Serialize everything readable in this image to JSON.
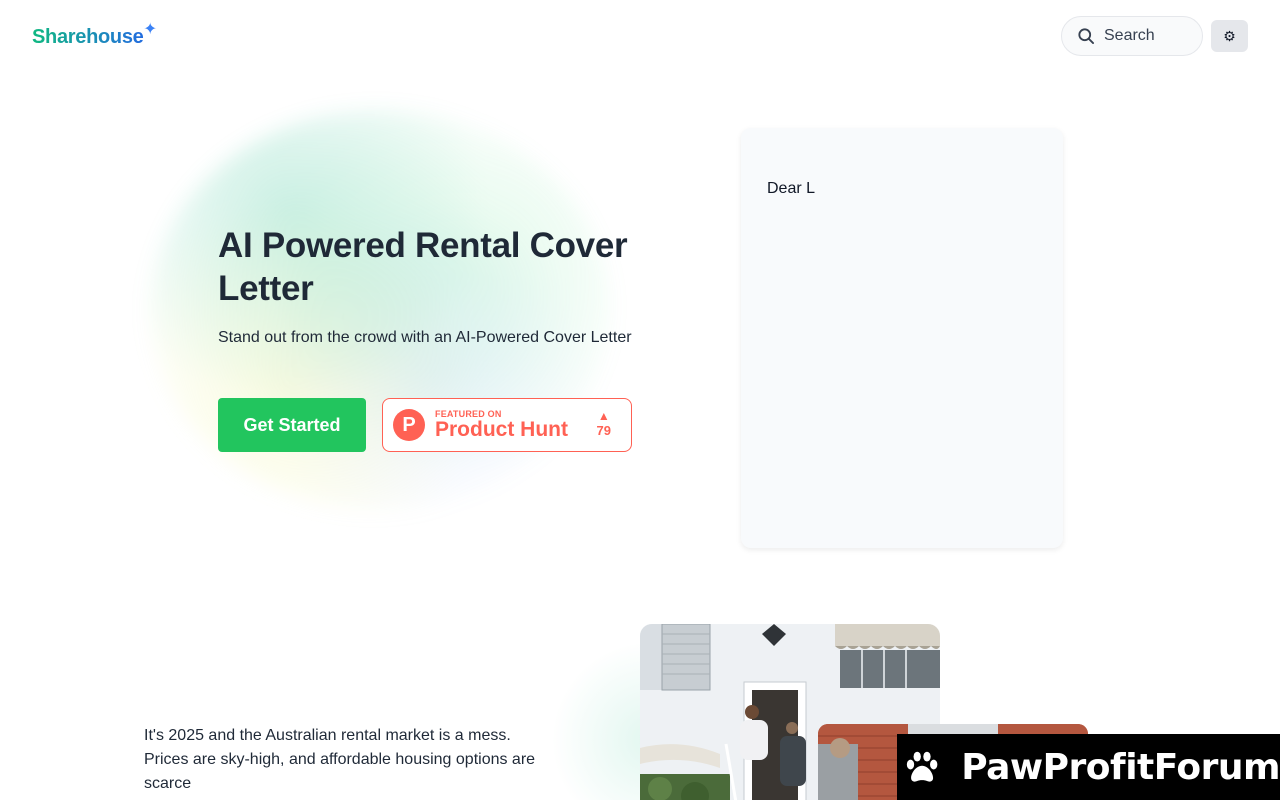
{
  "header": {
    "logo_text": "Sharehouse",
    "logo_spark": "✦",
    "search_label": "Search",
    "settings_glyph": "⚙"
  },
  "hero": {
    "title": "AI Powered Rental Cover Letter",
    "subtitle": "Stand out from the crowd with an AI-Powered Cover Letter",
    "cta_label": "Get Started",
    "product_hunt": {
      "logo_letter": "P",
      "featured_label": "FEATURED ON",
      "name": "Product Hunt",
      "arrow": "▲",
      "votes": "79"
    }
  },
  "letter_preview": {
    "text": "Dear L"
  },
  "intro": {
    "text": "It's 2025 and the Australian rental market is a mess. Prices are sky-high, and affordable housing options are scarce"
  },
  "watermark": {
    "text": "PawProfitForum"
  },
  "icons": {
    "search": "search-icon",
    "settings": "gear-icon",
    "paw": "paw-icon"
  },
  "colors": {
    "primary_green": "#22c55e",
    "product_hunt": "#ff6154",
    "logo_gradient_start": "#10b981",
    "logo_gradient_end": "#2563eb"
  }
}
